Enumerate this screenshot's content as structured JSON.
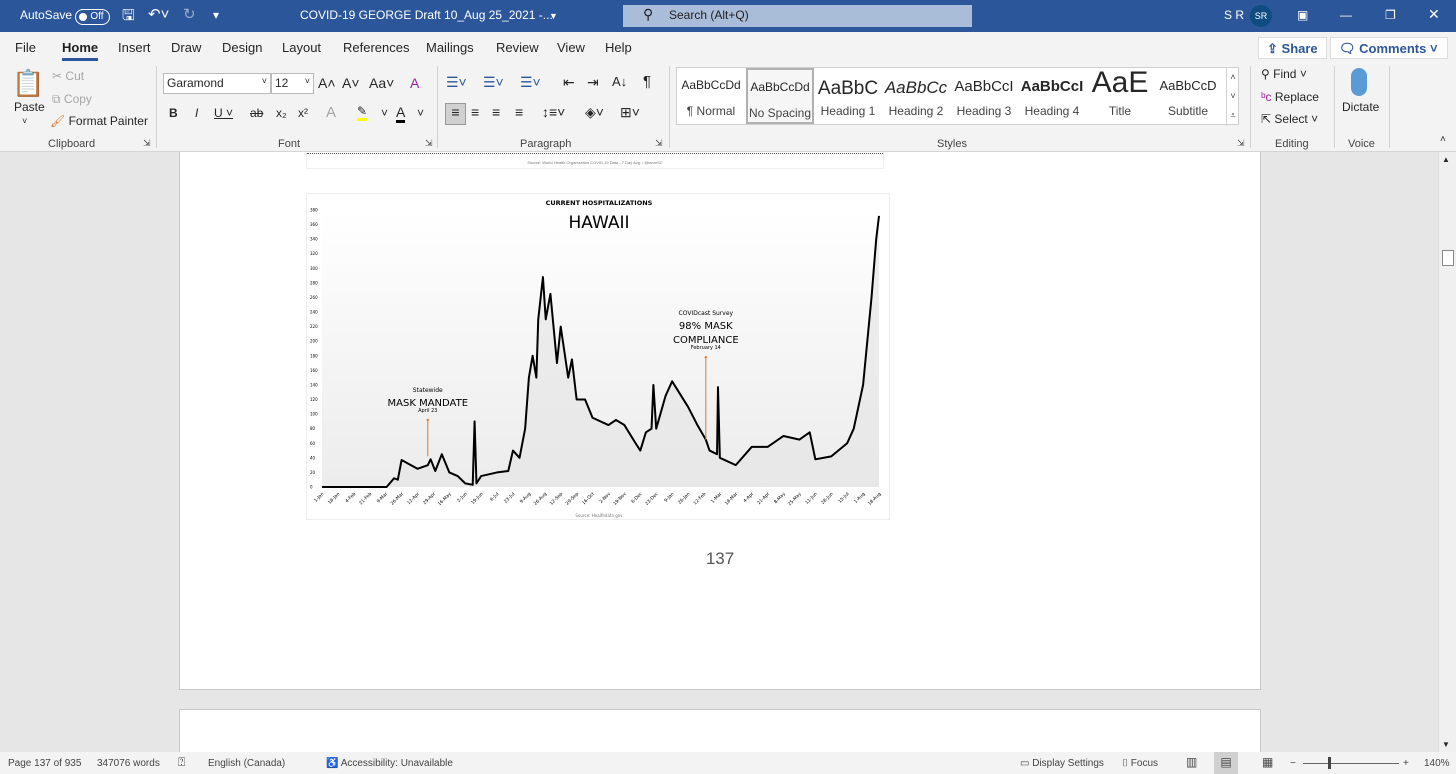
{
  "titlebar": {
    "autosave_label": "AutoSave",
    "autosave_state": "Off",
    "doc_title": "COVID-19 GEORGE Draft 10_Aug 25_2021  -...",
    "search_placeholder": "Search (Alt+Q)",
    "user_initials": "S R",
    "avatar": "SR"
  },
  "tabs": [
    "File",
    "Home",
    "Insert",
    "Draw",
    "Design",
    "Layout",
    "References",
    "Mailings",
    "Review",
    "View",
    "Help"
  ],
  "active_tab": "Home",
  "share_label": "Share",
  "comments_label": "Comments",
  "clipboard": {
    "paste": "Paste",
    "cut": "Cut",
    "copy": "Copy",
    "format_painter": "Format Painter",
    "group": "Clipboard"
  },
  "font": {
    "name": "Garamond",
    "size": "12",
    "group": "Font"
  },
  "paragraph": {
    "group": "Paragraph"
  },
  "styles": {
    "group": "Styles",
    "items": [
      {
        "preview": "AaBbCcDd",
        "name": "¶ Normal"
      },
      {
        "preview": "AaBbCcDd",
        "name": "No Spacing",
        "selected": true
      },
      {
        "preview": "AaBbC",
        "name": "Heading 1"
      },
      {
        "preview": "AaBbCc",
        "name": "Heading 2"
      },
      {
        "preview": "AaBbCcI",
        "name": "Heading 3"
      },
      {
        "preview": "AaBbCcI",
        "name": "Heading 4"
      },
      {
        "preview": "AaE",
        "name": "Title"
      },
      {
        "preview": "AaBbCcD",
        "name": "Subtitle"
      }
    ]
  },
  "editing": {
    "find": "Find",
    "replace": "Replace",
    "select": "Select",
    "group": "Editing"
  },
  "voice": {
    "dictate": "Dictate",
    "group": "Voice"
  },
  "document": {
    "prev_chart_source": "Source: World Health Organization COVID-19 Data - 7 Day Avg. / @ianmSC",
    "page_number": "137"
  },
  "chart_data": {
    "type": "line",
    "title": "CURRENT HOSPITALIZATIONS",
    "subtitle": "HAWAII",
    "source": "Source: Healthdata.gov",
    "ylim": [
      0,
      380
    ],
    "yticks": [
      0,
      20,
      40,
      60,
      80,
      100,
      120,
      140,
      160,
      180,
      200,
      220,
      240,
      260,
      280,
      300,
      320,
      340,
      360,
      380
    ],
    "xticks": [
      "1-Jan",
      "18-Jan",
      "4-Feb",
      "21-Feb",
      "9-Mar",
      "26-Mar",
      "12-Apr",
      "29-Apr",
      "16-May",
      "2-Jun",
      "19-Jun",
      "6-Jul",
      "23-Jul",
      "9-Aug",
      "26-Aug",
      "12-Sep",
      "29-Sep",
      "16-Oct",
      "2-Nov",
      "19-Nov",
      "6-Dec",
      "23-Dec",
      "9-Jan",
      "26-Jan",
      "12-Feb",
      "1-Mar",
      "18-Mar",
      "4-Apr",
      "21-Apr",
      "8-May",
      "25-May",
      "11-Jun",
      "28-Jun",
      "15-Jul",
      "1-Aug",
      "18-Aug"
    ],
    "xrange": [
      "2020-01-01",
      "2021-08-18"
    ],
    "points": [
      [
        "2020-01-01",
        0
      ],
      [
        "2020-03-10",
        0
      ],
      [
        "2020-03-18",
        12
      ],
      [
        "2020-03-22",
        10
      ],
      [
        "2020-03-26",
        37
      ],
      [
        "2020-04-12",
        25
      ],
      [
        "2020-04-23",
        30
      ],
      [
        "2020-04-26",
        38
      ],
      [
        "2020-05-01",
        22
      ],
      [
        "2020-05-08",
        45
      ],
      [
        "2020-05-16",
        20
      ],
      [
        "2020-05-25",
        15
      ],
      [
        "2020-06-02",
        5
      ],
      [
        "2020-06-10",
        3
      ],
      [
        "2020-06-12",
        90
      ],
      [
        "2020-06-14",
        5
      ],
      [
        "2020-06-19",
        15
      ],
      [
        "2020-07-06",
        20
      ],
      [
        "2020-07-18",
        22
      ],
      [
        "2020-07-23",
        50
      ],
      [
        "2020-07-30",
        40
      ],
      [
        "2020-08-05",
        80
      ],
      [
        "2020-08-09",
        150
      ],
      [
        "2020-08-13",
        180
      ],
      [
        "2020-08-17",
        150
      ],
      [
        "2020-08-19",
        230
      ],
      [
        "2020-08-24",
        288
      ],
      [
        "2020-08-27",
        230
      ],
      [
        "2020-09-01",
        265
      ],
      [
        "2020-09-08",
        170
      ],
      [
        "2020-09-12",
        220
      ],
      [
        "2020-09-20",
        150
      ],
      [
        "2020-09-24",
        175
      ],
      [
        "2020-09-29",
        120
      ],
      [
        "2020-10-08",
        120
      ],
      [
        "2020-10-16",
        95
      ],
      [
        "2020-11-02",
        85
      ],
      [
        "2020-11-10",
        92
      ],
      [
        "2020-11-19",
        85
      ],
      [
        "2020-12-01",
        60
      ],
      [
        "2020-12-06",
        50
      ],
      [
        "2020-12-12",
        75
      ],
      [
        "2020-12-18",
        80
      ],
      [
        "2020-12-20",
        140
      ],
      [
        "2020-12-23",
        80
      ],
      [
        "2021-01-02",
        125
      ],
      [
        "2021-01-09",
        145
      ],
      [
        "2021-01-26",
        110
      ],
      [
        "2021-02-05",
        85
      ],
      [
        "2021-02-14",
        65
      ],
      [
        "2021-02-18",
        50
      ],
      [
        "2021-02-26",
        45
      ],
      [
        "2021-02-27",
        137
      ],
      [
        "2021-03-01",
        40
      ],
      [
        "2021-03-18",
        30
      ],
      [
        "2021-04-04",
        55
      ],
      [
        "2021-04-21",
        55
      ],
      [
        "2021-05-08",
        70
      ],
      [
        "2021-05-25",
        65
      ],
      [
        "2021-06-05",
        75
      ],
      [
        "2021-06-11",
        38
      ],
      [
        "2021-06-28",
        42
      ],
      [
        "2021-07-15",
        60
      ],
      [
        "2021-07-22",
        80
      ],
      [
        "2021-08-01",
        140
      ],
      [
        "2021-08-10",
        260
      ],
      [
        "2021-08-15",
        340
      ],
      [
        "2021-08-18",
        372
      ]
    ],
    "annotations": [
      {
        "top": "Statewide",
        "main": "MASK MANDATE",
        "date_label": "April 23",
        "date": "2020-04-23",
        "from": 42,
        "to": 92
      },
      {
        "top": "COVIDcast Survey",
        "main": "98% MASK",
        "main2": "COMPLIANCE",
        "date_label": "February 14",
        "date": "2021-02-14",
        "from": 65,
        "to": 178
      }
    ],
    "line_color": "#000000",
    "annotation_color": "#e87722",
    "grid": false
  },
  "status": {
    "page": "Page 137 of 935",
    "words": "347076 words",
    "language": "English (Canada)",
    "accessibility": "Accessibility: Unavailable",
    "display_settings": "Display Settings",
    "focus": "Focus",
    "zoom": "140%",
    "zoom_percent": 140
  }
}
